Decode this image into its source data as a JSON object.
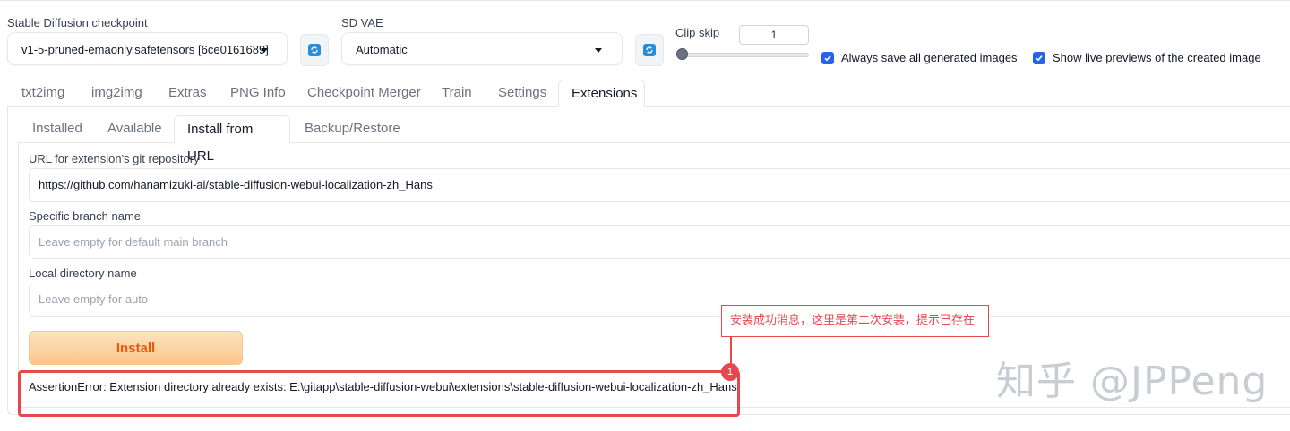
{
  "top": {
    "checkpoint": {
      "label": "Stable Diffusion checkpoint",
      "value": "v1-5-pruned-emaonly.safetensors [6ce0161689]"
    },
    "vae": {
      "label": "SD VAE",
      "value": "Automatic"
    },
    "clip_skip": {
      "label": "Clip skip",
      "value": "1",
      "slider_fraction": 0.0
    },
    "checkboxes": [
      {
        "label": "Always save all generated images",
        "checked": true
      },
      {
        "label": "Show live previews of the created image",
        "checked": true
      }
    ]
  },
  "tabs": [
    {
      "label": "txt2img"
    },
    {
      "label": "img2img"
    },
    {
      "label": "Extras"
    },
    {
      "label": "PNG Info"
    },
    {
      "label": "Checkpoint Merger"
    },
    {
      "label": "Train"
    },
    {
      "label": "Settings"
    },
    {
      "label": "Extensions",
      "active": true
    }
  ],
  "subtabs": [
    {
      "label": "Installed"
    },
    {
      "label": "Available"
    },
    {
      "label": "Install from URL",
      "active": true
    },
    {
      "label": "Backup/Restore"
    }
  ],
  "form": {
    "url": {
      "label": "URL for extension's git repository",
      "value": "https://github.com/hanamizuki-ai/stable-diffusion-webui-localization-zh_Hans"
    },
    "branch": {
      "label": "Specific branch name",
      "placeholder": "Leave empty for default main branch"
    },
    "local_dir": {
      "label": "Local directory name",
      "placeholder": "Leave empty for auto"
    },
    "install_label": "Install",
    "error_message": "AssertionError: Extension directory already exists: E:\\gitapp\\stable-diffusion-webui\\extensions\\stable-diffusion-webui-localization-zh_Hans"
  },
  "annotation": {
    "text": "安装成功消息，这里是第二次安装，提示已存在",
    "badge": "1",
    "color": "#e5484d"
  },
  "watermark": "知乎 @JPPeng",
  "colors": {
    "accent_blue": "#2563eb",
    "install_orange": "#ea580c",
    "annotation_red": "#e5484d"
  },
  "icons": {
    "refresh": "refresh-icon",
    "dropdown": "chevron-down-icon",
    "check": "check-icon"
  }
}
